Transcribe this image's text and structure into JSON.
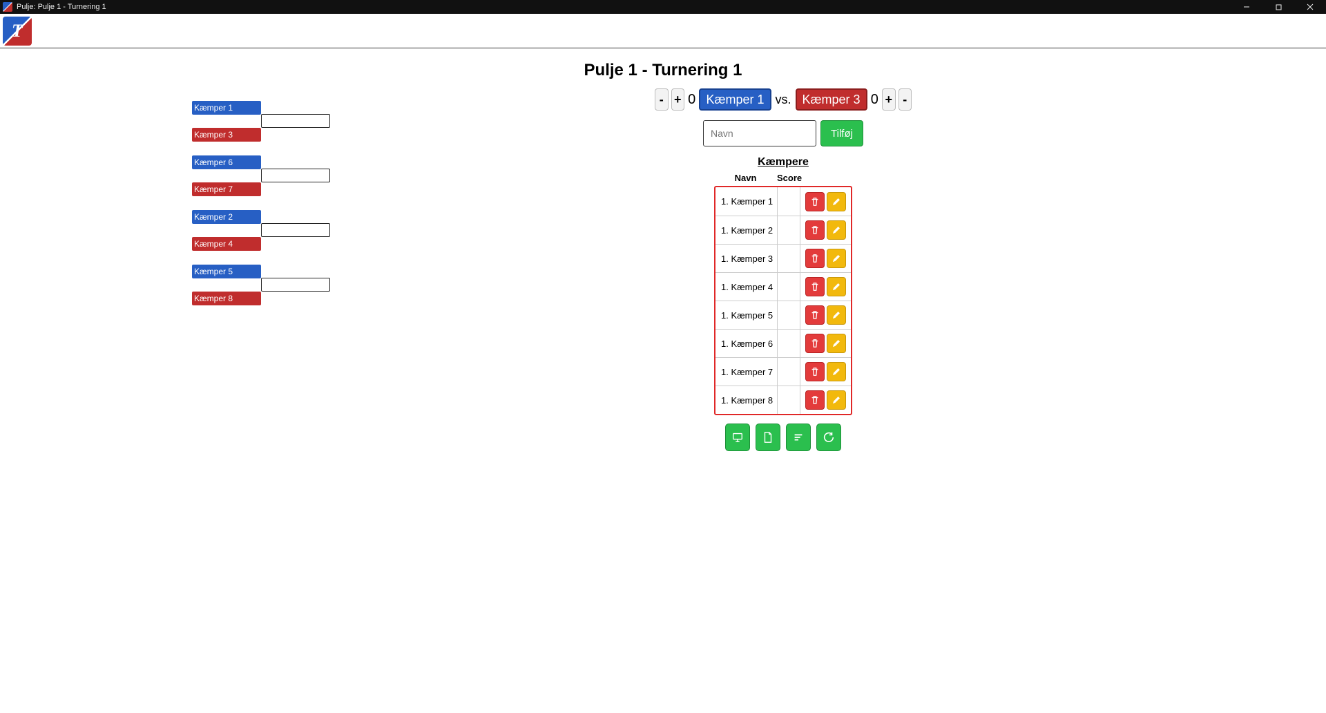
{
  "window": {
    "title": "Pulje: Pulje 1 - Turnering 1"
  },
  "app_logo_letter": "T",
  "page_title": "Pulje 1 - Turnering 1",
  "bracket": {
    "matches": [
      {
        "blue": "Kæmper 1",
        "red": "Kæmper 3"
      },
      {
        "blue": "Kæmper 6",
        "red": "Kæmper 7"
      },
      {
        "blue": "Kæmper 2",
        "red": "Kæmper 4"
      },
      {
        "blue": "Kæmper 5",
        "red": "Kæmper 8"
      }
    ]
  },
  "scoreboard": {
    "minus": "-",
    "plus": "+",
    "left_score": "0",
    "left_name": "Kæmper 1",
    "vs": "vs.",
    "right_name": "Kæmper 3",
    "right_score": "0"
  },
  "add": {
    "placeholder": "Navn",
    "button": "Tilføj"
  },
  "fighters": {
    "heading": "Kæmpere",
    "col_name": "Navn",
    "col_score": "Score",
    "rows": [
      {
        "label": "1. Kæmper 1"
      },
      {
        "label": "1. Kæmper 2"
      },
      {
        "label": "1. Kæmper 3"
      },
      {
        "label": "1. Kæmper 4"
      },
      {
        "label": "1. Kæmper 5"
      },
      {
        "label": "1. Kæmper 6"
      },
      {
        "label": "1. Kæmper 7"
      },
      {
        "label": "1. Kæmper 8"
      }
    ]
  }
}
